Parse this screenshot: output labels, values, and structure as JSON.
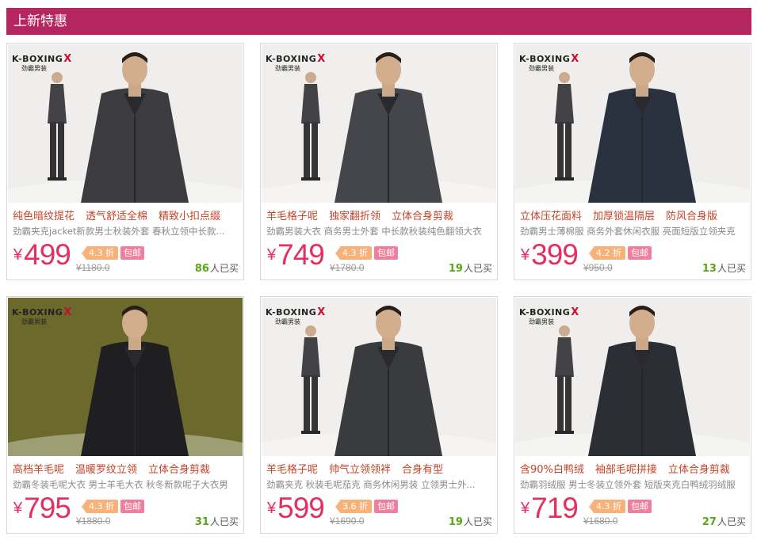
{
  "section": {
    "title": "上新特惠"
  },
  "logo": {
    "brand": "K-BOXING",
    "mark": "X",
    "sub": "劲霸男装"
  },
  "colors": {
    "header": "#b5255f",
    "price": "#e52e61",
    "features": "#c5432a",
    "sold_count": "#5aa514",
    "discount_badge": "#f7b27a",
    "free_ship_badge": "#f07f9d"
  },
  "products": [
    {
      "features": [
        "纯色暗纹提花",
        "透气舒适全棉",
        "精致小扣点缀"
      ],
      "description": "劲霸夹克jacket新款男士秋装外套 春秋立领中长款...",
      "currency": "¥",
      "price": "499",
      "discount": "4.3 折",
      "shipping": "包邮",
      "original_price": "¥1180.0",
      "sold": "86",
      "sold_suffix": "人已买",
      "image_subject": "man-dark-quilted-jacket",
      "backdrop": "#efeeec"
    },
    {
      "features": [
        "羊毛格子呢",
        "独家翻折领",
        "立体合身剪裁"
      ],
      "description": "劲霸男装大衣 商务男士外套 中长款秋装纯色翻领大衣",
      "currency": "¥",
      "price": "749",
      "discount": "4.3 折",
      "shipping": "包邮",
      "original_price": "¥1780.0",
      "sold": "19",
      "sold_suffix": "人已买",
      "image_subject": "man-grey-wool-coat",
      "backdrop": "#f0efed"
    },
    {
      "features": [
        "立体压花面料",
        "加厚锁温隔层",
        "防风合身版"
      ],
      "description": "劲霸男士薄棉服 商务外套休闲衣服 亮面短版立领夹克",
      "currency": "¥",
      "price": "399",
      "discount": "4.2 折",
      "shipping": "包邮",
      "original_price": "¥950.0",
      "sold": "13",
      "sold_suffix": "人已买",
      "image_subject": "man-navy-padded-jacket",
      "backdrop": "#efeeec"
    },
    {
      "features": [
        "高档羊毛呢",
        "温暖罗纹立领",
        "立体合身剪裁"
      ],
      "description": "劲霸冬装毛呢大衣 男士羊毛大衣 秋冬新款呢子大衣男",
      "currency": "¥",
      "price": "795",
      "discount": "4.3 折",
      "shipping": "包邮",
      "original_price": "¥1880.0",
      "sold": "31",
      "sold_suffix": "人已买",
      "image_subject": "man-black-wool-coat-seated",
      "backdrop": "#6b6a2c"
    },
    {
      "features": [
        "羊毛格子呢",
        "帅气立领领袢",
        "合身有型"
      ],
      "description": "劲霸夹克 秋装毛呢茄克 商务休闲男装 立领男士外...",
      "currency": "¥",
      "price": "599",
      "discount": "3.6 折",
      "shipping": "包邮",
      "original_price": "¥1690.0",
      "sold": "19",
      "sold_suffix": "人已买",
      "image_subject": "man-charcoal-wool-jacket",
      "backdrop": "#f0efed"
    },
    {
      "features": [
        "含90%白鸭绒",
        "袖部毛呢拼接",
        "立体合身剪裁"
      ],
      "description": "劲霸羽绒服 男士冬装立领外套 短版夹克白鸭绒羽绒服",
      "currency": "¥",
      "price": "719",
      "discount": "4.3 折",
      "shipping": "包邮",
      "original_price": "¥1680.0",
      "sold": "27",
      "sold_suffix": "人已买",
      "image_subject": "man-dark-down-jacket",
      "backdrop": "#efeeec"
    }
  ]
}
